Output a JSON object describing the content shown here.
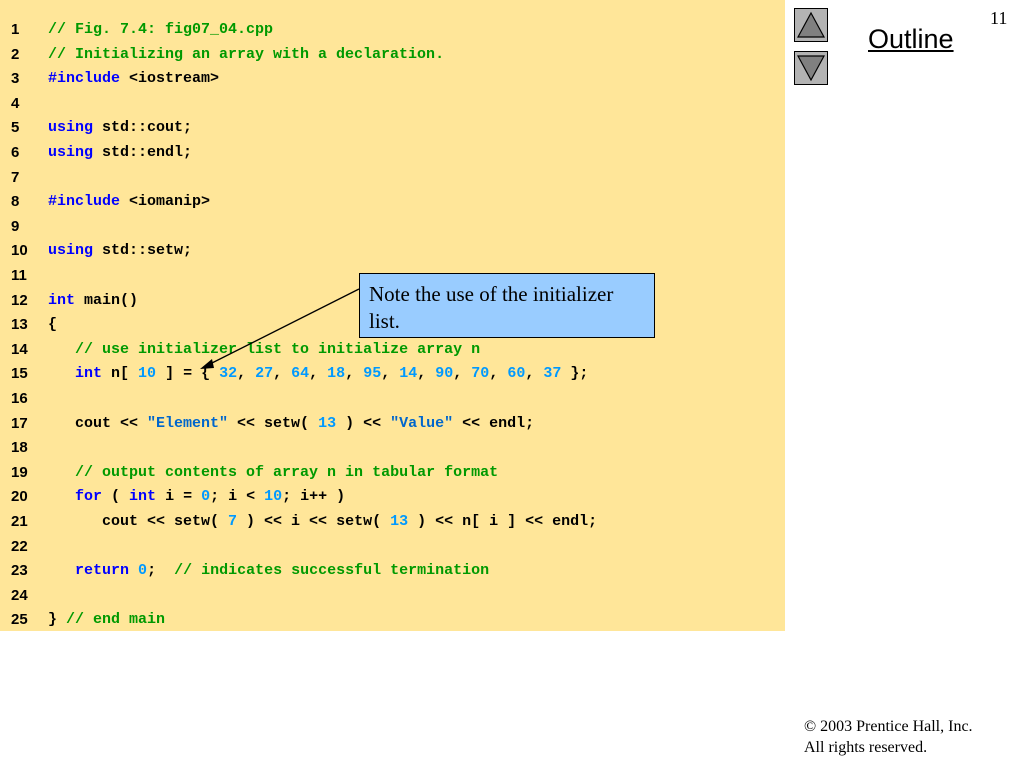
{
  "slide_number": "11",
  "outline_label": "Outline",
  "footer": {
    "line1": "© 2003 Prentice Hall, Inc.",
    "line2": "All rights reserved."
  },
  "callout": "Note the use of the initializer list.",
  "nav": {
    "up_icon": "triangle-up-icon",
    "down_icon": "triangle-down-icon"
  },
  "colors": {
    "keyword": "#0000ff",
    "comment": "#009900",
    "string": "#0066cc",
    "number": "#0099ff",
    "plain": "#000000",
    "panel": "#ffe699",
    "callout": "#99ccff"
  },
  "code_lines": [
    {
      "n": "1",
      "tokens": [
        [
          "cm",
          "// Fig. 7.4: fig07_04.cpp"
        ]
      ]
    },
    {
      "n": "2",
      "tokens": [
        [
          "cm",
          "// Initializing an array with a declaration."
        ]
      ]
    },
    {
      "n": "3",
      "tokens": [
        [
          "kw",
          "#include"
        ],
        [
          "pl",
          " <iostream>"
        ]
      ]
    },
    {
      "n": "4",
      "tokens": []
    },
    {
      "n": "5",
      "tokens": [
        [
          "kw",
          "using"
        ],
        [
          "pl",
          " std::cout;"
        ]
      ]
    },
    {
      "n": "6",
      "tokens": [
        [
          "kw",
          "using"
        ],
        [
          "pl",
          " std::endl;"
        ]
      ]
    },
    {
      "n": "7",
      "tokens": []
    },
    {
      "n": "8",
      "tokens": [
        [
          "kw",
          "#include"
        ],
        [
          "pl",
          " <iomanip>"
        ]
      ]
    },
    {
      "n": "9",
      "tokens": []
    },
    {
      "n": "10",
      "tokens": [
        [
          "kw",
          "using"
        ],
        [
          "pl",
          " std::setw;"
        ]
      ]
    },
    {
      "n": "11",
      "tokens": []
    },
    {
      "n": "12",
      "tokens": [
        [
          "kw",
          "int"
        ],
        [
          "pl",
          " main()"
        ]
      ]
    },
    {
      "n": "13",
      "tokens": [
        [
          "pl",
          "{"
        ]
      ]
    },
    {
      "n": "14",
      "tokens": [
        [
          "pl",
          "   "
        ],
        [
          "cm",
          "// use initializer list to initialize array n"
        ]
      ]
    },
    {
      "n": "15",
      "tokens": [
        [
          "pl",
          "   "
        ],
        [
          "kw",
          "int"
        ],
        [
          "pl",
          " n[ "
        ],
        [
          "num",
          "10"
        ],
        [
          "pl",
          " ] = { "
        ],
        [
          "num",
          "32"
        ],
        [
          "pl",
          ", "
        ],
        [
          "num",
          "27"
        ],
        [
          "pl",
          ", "
        ],
        [
          "num",
          "64"
        ],
        [
          "pl",
          ", "
        ],
        [
          "num",
          "18"
        ],
        [
          "pl",
          ", "
        ],
        [
          "num",
          "95"
        ],
        [
          "pl",
          ", "
        ],
        [
          "num",
          "14"
        ],
        [
          "pl",
          ", "
        ],
        [
          "num",
          "90"
        ],
        [
          "pl",
          ", "
        ],
        [
          "num",
          "70"
        ],
        [
          "pl",
          ", "
        ],
        [
          "num",
          "60"
        ],
        [
          "pl",
          ", "
        ],
        [
          "num",
          "37"
        ],
        [
          "pl",
          " };"
        ]
      ]
    },
    {
      "n": "16",
      "tokens": []
    },
    {
      "n": "17",
      "tokens": [
        [
          "pl",
          "   cout << "
        ],
        [
          "str",
          "\"Element\""
        ],
        [
          "pl",
          " << setw( "
        ],
        [
          "num",
          "13"
        ],
        [
          "pl",
          " ) << "
        ],
        [
          "str",
          "\"Value\""
        ],
        [
          "pl",
          " << endl;"
        ]
      ]
    },
    {
      "n": "18",
      "tokens": []
    },
    {
      "n": "19",
      "tokens": [
        [
          "pl",
          "   "
        ],
        [
          "cm",
          "// output contents of array n in tabular format"
        ]
      ]
    },
    {
      "n": "20",
      "tokens": [
        [
          "pl",
          "   "
        ],
        [
          "kw",
          "for"
        ],
        [
          "pl",
          " ( "
        ],
        [
          "kw",
          "int"
        ],
        [
          "pl",
          " i = "
        ],
        [
          "num",
          "0"
        ],
        [
          "pl",
          "; i < "
        ],
        [
          "num",
          "10"
        ],
        [
          "pl",
          "; i++ )"
        ]
      ]
    },
    {
      "n": "21",
      "tokens": [
        [
          "pl",
          "      cout << setw( "
        ],
        [
          "num",
          "7"
        ],
        [
          "pl",
          " ) << i << setw( "
        ],
        [
          "num",
          "13"
        ],
        [
          "pl",
          " ) << n[ i ] << endl;"
        ]
      ]
    },
    {
      "n": "22",
      "tokens": []
    },
    {
      "n": "23",
      "tokens": [
        [
          "pl",
          "   "
        ],
        [
          "kw",
          "return"
        ],
        [
          "pl",
          " "
        ],
        [
          "num",
          "0"
        ],
        [
          "pl",
          ";  "
        ],
        [
          "cm",
          "// indicates successful termination"
        ]
      ]
    },
    {
      "n": "24",
      "tokens": []
    },
    {
      "n": "25",
      "tokens": [
        [
          "pl",
          "} "
        ],
        [
          "cm",
          "// end main"
        ]
      ]
    }
  ]
}
